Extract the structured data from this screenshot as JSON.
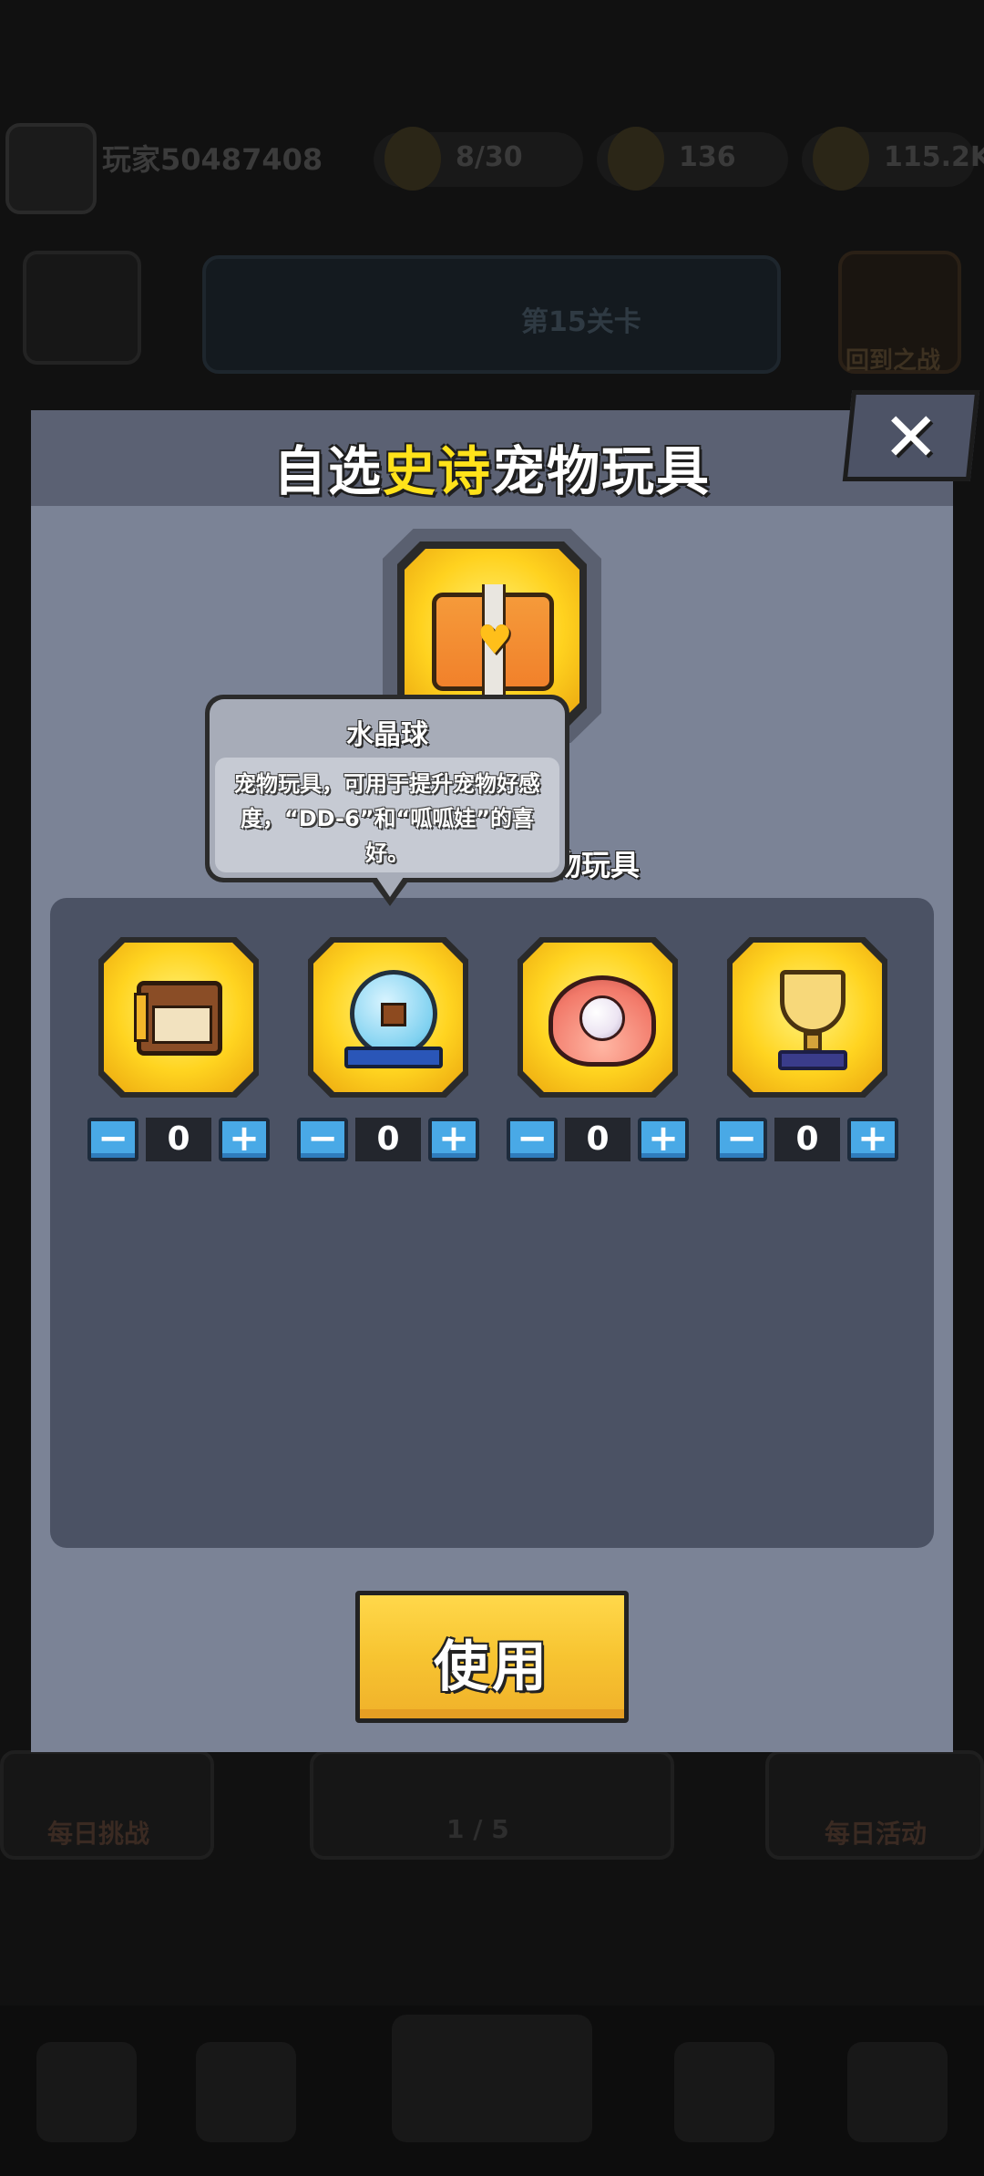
{
  "background": {
    "player_name": "玩家50487408",
    "stats": [
      {
        "icon": "energy-icon",
        "value": "8/30"
      },
      {
        "icon": "gem-icon",
        "value": "136"
      },
      {
        "icon": "coin-icon",
        "value": "115.2K"
      }
    ],
    "banner_text": "第15关卡",
    "right_button_label": "回到之战",
    "bottom_cards": [
      {
        "label": "每日挑战"
      },
      {
        "label": "每日活动"
      }
    ],
    "bottom_center_value": "1 / 5"
  },
  "dialog": {
    "title_prefix": "自选",
    "title_highlight": "史诗",
    "title_suffix": "宠物玩具",
    "close_label": "✕",
    "subtitle_partial": "物玩具",
    "tooltip": {
      "title": "水晶球",
      "description": "宠物玩具，可用于提升宠物好感度，“DD-6”和“呱呱娃”的喜好。"
    },
    "items": [
      {
        "icon": "music-box-chest-icon",
        "quantity": "0"
      },
      {
        "icon": "snow-globe-icon",
        "quantity": "0"
      },
      {
        "icon": "pearl-shell-icon",
        "quantity": "0"
      },
      {
        "icon": "golden-trophy-icon",
        "quantity": "0"
      }
    ],
    "stepper": {
      "minus": "−",
      "plus": "+"
    },
    "use_button": "使用"
  },
  "colors": {
    "highlight": "#ffe21a",
    "dialog_bg": "#7b8396",
    "panel_bg": "#4b5264",
    "stepper_blue": "#49a9e6",
    "use_button": "#f7c431"
  }
}
